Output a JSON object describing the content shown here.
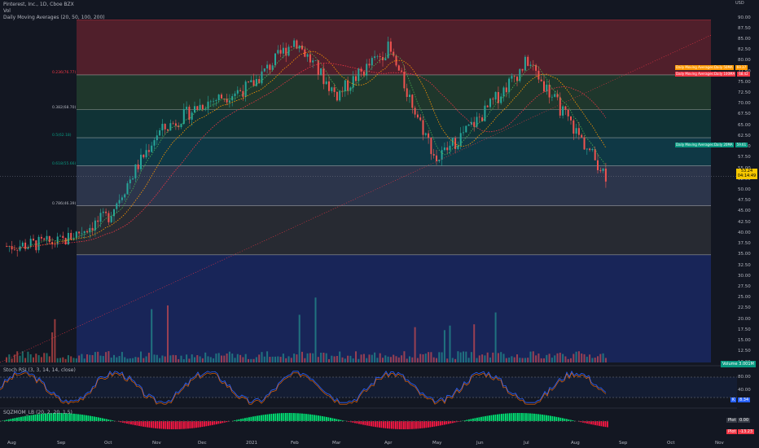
{
  "header": {
    "symbol_line": "Pinterest, Inc., 1D, Cboe BZX",
    "vol_label": "Vol",
    "ma_label": "Daily Moving Averages (20, 50, 100, 200)"
  },
  "currency": "USD",
  "y_axis_ticks": [
    "90.00",
    "87.50",
    "85.00",
    "82.50",
    "80.00",
    "77.50",
    "75.00",
    "72.50",
    "70.00",
    "67.50",
    "65.00",
    "62.50",
    "60.00",
    "57.50",
    "55.00",
    "52.50",
    "50.00",
    "47.50",
    "45.00",
    "42.50",
    "40.00",
    "37.50",
    "35.00",
    "32.50",
    "30.00",
    "27.50",
    "25.00",
    "22.50",
    "20.00",
    "17.50",
    "15.00",
    "12.50",
    "10.00"
  ],
  "x_axis_ticks": [
    "Aug",
    "Sep",
    "Oct",
    "Nov",
    "Dec",
    "2021",
    "Feb",
    "Mar",
    "Apr",
    "May",
    "Jun",
    "Jul",
    "Aug",
    "Sep",
    "Oct",
    "Nov"
  ],
  "fib_levels": [
    {
      "label": "0.236(76.77)",
      "color": "#f23645"
    },
    {
      "label": "0.382(68.70)",
      "color": "#b2b5be"
    },
    {
      "label": "0.5(62.18)",
      "color": "#089981"
    },
    {
      "label": "0.618(55.66)",
      "color": "#089981"
    },
    {
      "label": "0.786(46.39)",
      "color": "#b2b5be"
    }
  ],
  "ma_tags": [
    {
      "text": "Daily Moving Averages:Daily 50MA",
      "value": "69.37",
      "color": "#ff9800"
    },
    {
      "text": "Daily Moving Averages:Daily 100MA",
      "value": "68.42",
      "color": "#f23645"
    },
    {
      "text": "Daily Moving Averages:Daily 20MA",
      "value": "59.61",
      "color": "#089981"
    }
  ],
  "price_tag": {
    "value": "53.24",
    "countdown": "04:14:49"
  },
  "volume_tag": "Volume 3.001M",
  "stoch": {
    "label": "Stoch RSI (3, 3, 14, 14, close)",
    "ticks": [
      "80.00",
      "40.00"
    ],
    "k_value": "8.34",
    "k_label": "K"
  },
  "sqzmom": {
    "label": "SQZMOM_LB (20, 2, 20, 1.5)",
    "plot1": "0.00",
    "plot2": "-13.23",
    "plot_label": "Plot"
  },
  "chart_data": {
    "type": "candlestick",
    "title": "Pinterest, Inc., 1D, Cboe BZX",
    "x_range": [
      "Aug 2020",
      "Nov 2021"
    ],
    "ylim": [
      10,
      90
    ],
    "approx_closes": [
      {
        "date": "Aug 2020",
        "value": 37
      },
      {
        "date": "Sep 2020",
        "value": 38
      },
      {
        "date": "Oct 2020",
        "value": 44
      },
      {
        "date": "Nov 2020",
        "value": 63
      },
      {
        "date": "Dec 2020",
        "value": 70
      },
      {
        "date": "Jan 2021",
        "value": 74
      },
      {
        "date": "Feb 2021",
        "value": 85
      },
      {
        "date": "Mar 2021",
        "value": 72
      },
      {
        "date": "Apr 2021",
        "value": 83
      },
      {
        "date": "May 2021",
        "value": 57
      },
      {
        "date": "Jun 2021",
        "value": 67
      },
      {
        "date": "Jul 2021",
        "value": 80
      },
      {
        "date": "Aug 2021",
        "value": 53.24
      }
    ],
    "fib_values": [
      76.77,
      68.7,
      62.18,
      55.66,
      46.39
    ]
  }
}
